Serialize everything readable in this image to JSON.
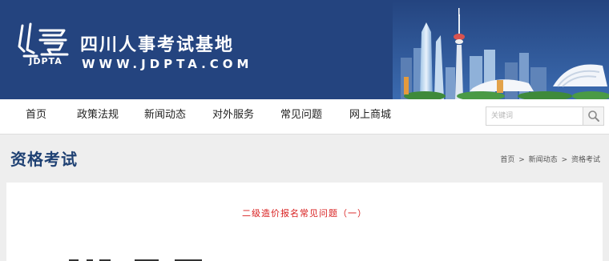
{
  "header": {
    "site_name": "四川人事考试基地",
    "site_url": "WWW.JDPTA.COM",
    "logo_abbr": "JDPTA",
    "colors": {
      "banner": "#24447f",
      "accent": "#1f4173"
    }
  },
  "nav": {
    "items": [
      {
        "label": "首页"
      },
      {
        "label": "政策法规"
      },
      {
        "label": "新闻动态"
      },
      {
        "label": "对外服务"
      },
      {
        "label": "常见问题"
      },
      {
        "label": "网上商城"
      }
    ]
  },
  "search": {
    "placeholder": "关键词",
    "icon": "search-icon"
  },
  "page": {
    "title": "资格考试"
  },
  "breadcrumb": {
    "items": [
      "首页",
      "新闻动态",
      "资格考试"
    ],
    "separator": ">"
  },
  "article": {
    "title": "二级造价报名常见问题（一）",
    "title_color": "#d81e1e"
  }
}
